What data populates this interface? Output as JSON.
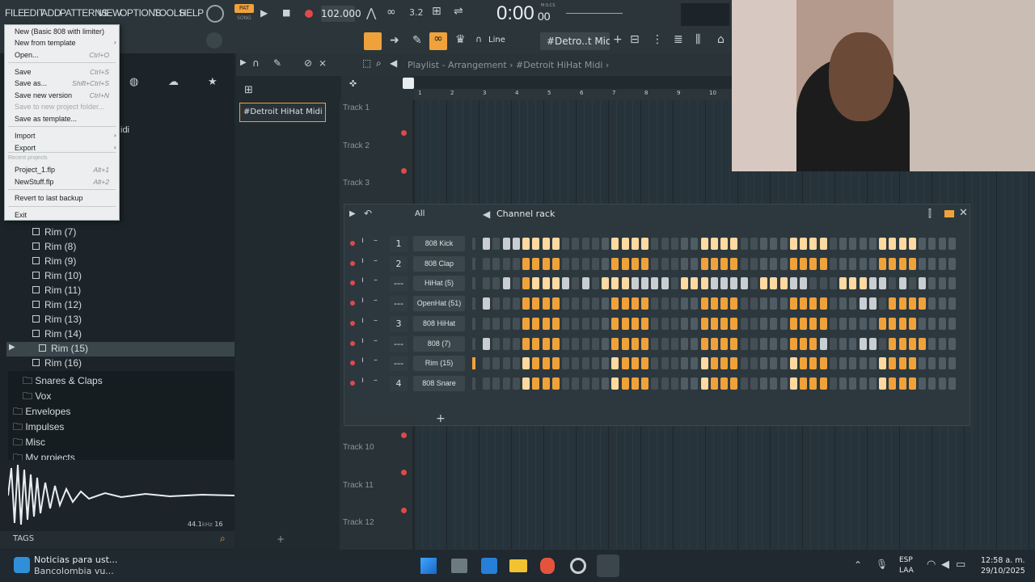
{
  "menubar": {
    "items": [
      "FILE",
      "EDIT",
      "ADD",
      "PATTERNS",
      "VIEW",
      "OPTIONS",
      "TOOLS",
      "HELP"
    ],
    "pat_label": "PAT",
    "song_label": "SONG",
    "tempo": "102.000",
    "time": "0:00",
    "time_small": "00",
    "time_unit": "M:S:CS"
  },
  "toolbar2": {
    "snap_mode": "Line",
    "pattern_name": "#Detro..t Midi"
  },
  "playlist": {
    "breadcrumb": "Playlist - Arrangement › #Detroit HiHat Midi ›",
    "pattern_clip": "#Detroit HiHat Midi",
    "ruler": [
      "1",
      "2",
      "3",
      "4",
      "5",
      "6",
      "7",
      "8",
      "9",
      "10"
    ],
    "tracks": [
      "Track 1",
      "Track 2",
      "Track 3",
      "Track 10",
      "Track 11",
      "Track 12"
    ]
  },
  "file_menu": {
    "items": [
      {
        "label": "New (Basic 808 with limiter)",
        "shortcut": "",
        "arrow": false,
        "disabled": false
      },
      {
        "label": "New from template",
        "shortcut": "",
        "arrow": true,
        "disabled": false
      },
      {
        "label": "Open...",
        "shortcut": "Ctrl+O",
        "arrow": false,
        "disabled": false
      },
      {
        "label": "Save",
        "shortcut": "Ctrl+S",
        "arrow": false,
        "disabled": false
      },
      {
        "label": "Save as...",
        "shortcut": "Shift+Ctrl+S",
        "arrow": false,
        "disabled": false
      },
      {
        "label": "Save new version",
        "shortcut": "Ctrl+N",
        "arrow": false,
        "disabled": false
      },
      {
        "label": "Save to new project folder...",
        "shortcut": "",
        "arrow": false,
        "disabled": true
      },
      {
        "label": "Save as template...",
        "shortcut": "",
        "arrow": false,
        "disabled": false
      },
      {
        "label": "Import",
        "shortcut": "",
        "arrow": true,
        "disabled": false
      },
      {
        "label": "Export",
        "shortcut": "",
        "arrow": true,
        "disabled": false
      },
      {
        "label": "Recent projects",
        "shortcut": "",
        "arrow": false,
        "disabled": true
      },
      {
        "label": "Project_1.flp",
        "shortcut": "Alt+1",
        "arrow": false,
        "disabled": false
      },
      {
        "label": "NewStuff.flp",
        "shortcut": "Alt+2",
        "arrow": false,
        "disabled": false
      },
      {
        "label": "Revert to last backup",
        "shortcut": "",
        "arrow": false,
        "disabled": false
      },
      {
        "label": "Exit",
        "shortcut": "",
        "arrow": false,
        "disabled": false
      }
    ]
  },
  "browser": {
    "partial_text": "idi",
    "files": [
      "Rim (7)",
      "Rim (8)",
      "Rim (9)",
      "Rim (10)",
      "Rim (11)",
      "Rim (12)",
      "Rim (13)",
      "Rim (14)",
      "Rim (15)",
      "Rim (16)"
    ],
    "selected": "Rim (15)",
    "folders": [
      "Snares & Claps",
      "Vox"
    ],
    "top_folders": [
      "Envelopes",
      "Impulses",
      "Misc",
      "My projects"
    ],
    "sample_rate": "44.1",
    "sample_rate_unit": "kHz",
    "bit_depth": "16",
    "tags_label": "TAGS"
  },
  "channel_rack": {
    "title": "Channel rack",
    "filter": "All",
    "channels": [
      {
        "num": "1",
        "name": "808 Kick",
        "steps": "w.wwhhhh.....hhhh.....hhhh.....hhhh.....hhhh...."
      },
      {
        "num": "2",
        "name": "808 Clap",
        "steps": "....oooo.....oooo.....oooo.....oooo.....oooo...."
      },
      {
        "num": "---",
        "name": "HiHat (5)",
        "steps": "..w.ohhhw.w.hhhwwww.hhhwwww.hhhww...hhhww.w.w.."
      },
      {
        "num": "---",
        "name": "OpenHat (51)",
        "steps": "w...oooo.....oooo.....oooo.....oooo...ww.oooo...."
      },
      {
        "num": "3",
        "name": "808 HiHat",
        "steps": "....oooo.....oooo.....oooo.....oooo.....oooo...."
      },
      {
        "num": "---",
        "name": "808 (7)",
        "steps": "w...oooo.....oooo.....oooo.....ooow...ww.oooo...."
      },
      {
        "num": "---",
        "name": "Rim (15)",
        "steps": "....hooo.....hooo.....hooo.....hooo.....hooo...."
      },
      {
        "num": "4",
        "name": "808 Snare",
        "steps": "....hooo.....hooo.....hooo.....hooo.....hooo...."
      }
    ]
  },
  "taskbar": {
    "news_title": "Noticias para ust...",
    "news_sub": "Bancolombia vu...",
    "lang": "ESP",
    "lang_sub": "LAA",
    "time": "12:58 a. m.",
    "date": "29/10/2025"
  }
}
